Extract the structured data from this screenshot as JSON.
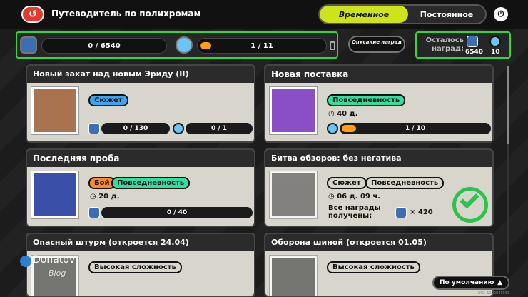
{
  "header": {
    "title": "Путеводитель по полихромам",
    "tab_active": "Временное",
    "tab_inactive": "Постоянное"
  },
  "progress": {
    "points": "0 / 6540",
    "stages": "1 / 11",
    "stage_fraction": 0.09
  },
  "description_button": "Описание наград",
  "remaining": {
    "label": "Осталось наград:",
    "value1": "6540",
    "value2": "10"
  },
  "cards": [
    {
      "title": "Новый закат над новым Эриду (II)",
      "tags": [
        "Сюжет"
      ],
      "bar1": "0 / 130",
      "bar2": "0 / 1"
    },
    {
      "title": "Новая поставка",
      "tags": [
        "Повседневность"
      ],
      "timer": "40 д.",
      "bar1": "1 / 10",
      "bar1_fraction": 0.1
    },
    {
      "title": "Последняя проба",
      "tags": [
        "Бой",
        "Повседневность"
      ],
      "timer": "20 д.",
      "bar1": "0 / 40"
    },
    {
      "title": "Битва обзоров: без негатива",
      "tags": [
        "Сюжет",
        "Повседневность"
      ],
      "timer": "06 д. 09 ч.",
      "done_label": "Все награды получены:",
      "done_value": "× 420"
    },
    {
      "title": "Опасный штурм (откроется 24.04)",
      "tags": [
        "Высокая сложность"
      ]
    },
    {
      "title": "Оборона шиной (откроется 01.05)",
      "tags": [
        "Высокая сложность"
      ]
    }
  ],
  "sort": {
    "label": "По умолчанию"
  },
  "uid": "UID: 1000049933",
  "watermark": {
    "name": "Donatov",
    "sub": "Blog"
  },
  "colors": {
    "accent": "#cfe31a",
    "highlight": "#35d63a",
    "progress_fill": "#ff9e1b"
  }
}
